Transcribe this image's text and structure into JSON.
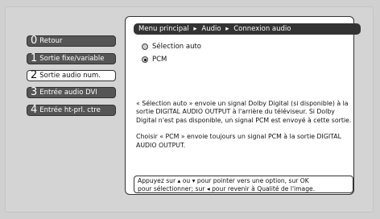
{
  "breadcrumb": {
    "items": [
      "Menu principal",
      "Audio",
      "Connexion audio"
    ],
    "separator": "▸"
  },
  "menu": {
    "items": [
      {
        "number": "0",
        "label": "Retour",
        "selected": false
      },
      {
        "number": "1",
        "label": "Sortie fixe/variable",
        "selected": false
      },
      {
        "number": "2",
        "label": "Sortie audio num.",
        "selected": true
      },
      {
        "number": "3",
        "label": "Entrée audio DVI",
        "selected": false
      },
      {
        "number": "4",
        "label": "Entrée ht-prl. ctre",
        "selected": false
      }
    ]
  },
  "options": [
    {
      "label": "Sélection auto",
      "selected": false
    },
    {
      "label": "PCM",
      "selected": true
    }
  ],
  "description": {
    "p1": "« Sélection auto » envoie un signal Dolby Digital (si disponible) à la sortie DIGITAL AUDIO OUTPUT à l'arrière du téléviseur. Si Dolby Digital n'est pas disponible, un signal PCM est envoyé à cette sortie.",
    "p2": "Choisir « PCM » envoie toujours un signal PCM à la sortie DIGITAL AUDIO OUTPUT."
  },
  "help": {
    "line1_a": "Appuyez sur",
    "line1_b": "ou",
    "line1_c": "pour pointer vers une option, sur OK",
    "line2_a": "pour sélectionner; sur",
    "line2_b": "pour revenir à Qualité de l'image."
  }
}
